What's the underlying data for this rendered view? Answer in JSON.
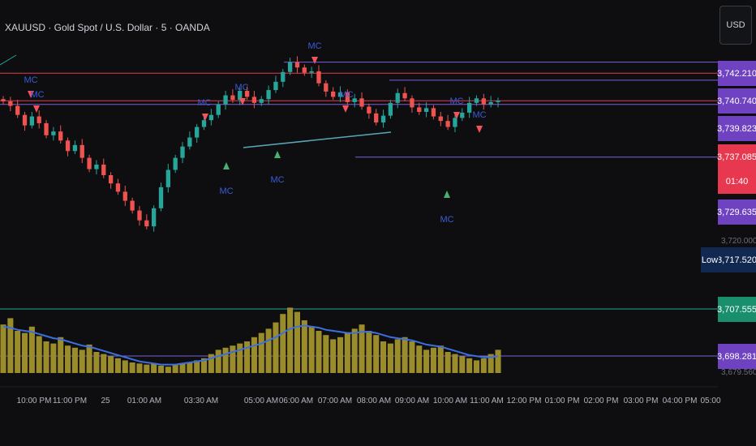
{
  "symbol": {
    "title": "XAUUSD · Gold Spot / U.S. Dollar · 5 · OANDA"
  },
  "currency_button": {
    "label": "USD"
  },
  "price_labels": [
    {
      "value": "3,742.210",
      "color": "#6f42c1"
    },
    {
      "value": "3,740.740",
      "color": "#6f42c1"
    },
    {
      "value": "3,739.823",
      "color": "#6f42c1"
    },
    {
      "value": "3,737.085",
      "color": "#e8384f"
    },
    {
      "value": "01:40",
      "color": "#e8384f"
    },
    {
      "value": "3,729.635",
      "color": "#6f42c1"
    },
    {
      "value": "3,717.520",
      "color": "#112850"
    },
    {
      "value": "3,707.555",
      "color": "#1a8f6e"
    },
    {
      "value": "3,698.281",
      "color": "#6f42c1"
    }
  ],
  "low_tag": "Low",
  "partial_axis_labels": [
    "3,720.000",
    "3,679.560"
  ],
  "time_axis": [
    "10:00 PM",
    "11:00 PM",
    "25",
    "01:00 AM",
    "03:30 AM",
    "05:00 AM",
    "06:00 AM",
    "07:00 AM",
    "08:00 AM",
    "09:00 AM",
    "10:00 AM",
    "11:00 AM",
    "12:00 PM",
    "01:00 PM",
    "02:00 PM",
    "03:00 PM",
    "04:00 PM",
    "05:00"
  ],
  "marker_text": "MC",
  "colors": {
    "bull": "#26a69a",
    "bear": "#ef5350",
    "volume": "#9a8c2a",
    "volume_ma": "#3c6fe0",
    "line_purple": "#7b5fd6",
    "line_red": "#e8384f",
    "line_teal": "#26a69a"
  },
  "chart_data": {
    "type": "candlestick",
    "price_series": [
      3737.0,
      3736.4,
      3735.2,
      3733.8,
      3735.0,
      3734.1,
      3732.5,
      3733.0,
      3731.8,
      3730.4,
      3731.2,
      3729.5,
      3728.0,
      3728.6,
      3727.2,
      3726.1,
      3725.0,
      3723.8,
      3722.5,
      3721.2,
      3720.4,
      3722.8,
      3725.6,
      3727.9,
      3729.5,
      3731.0,
      3732.2,
      3733.6,
      3734.5,
      3735.2,
      3736.6,
      3737.8,
      3737.2,
      3738.4,
      3737.6,
      3736.8,
      3737.3,
      3738.5,
      3739.6,
      3740.9,
      3742.2,
      3741.5,
      3740.8,
      3741.0,
      3739.4,
      3738.3,
      3737.6,
      3738.2,
      3736.9,
      3737.4,
      3736.3,
      3735.4,
      3734.2,
      3735.1,
      3736.8,
      3738.1,
      3737.4,
      3736.2,
      3735.6,
      3736.1,
      3735.0,
      3734.4,
      3733.6,
      3734.8,
      3735.5,
      3736.8,
      3737.4,
      3736.6,
      3736.9,
      3737.1
    ],
    "volume_series": [
      46,
      52,
      40,
      38,
      44,
      35,
      30,
      28,
      34,
      26,
      24,
      22,
      27,
      20,
      18,
      16,
      14,
      12,
      10,
      9,
      8,
      9,
      7,
      6,
      8,
      9,
      10,
      12,
      14,
      18,
      22,
      24,
      26,
      28,
      30,
      34,
      38,
      42,
      48,
      56,
      62,
      58,
      50,
      44,
      40,
      36,
      32,
      34,
      38,
      42,
      46,
      40,
      36,
      30,
      28,
      32,
      34,
      30,
      26,
      22,
      24,
      26,
      20,
      18,
      16,
      14,
      12,
      14,
      18,
      22
    ],
    "volume_ma": [
      44,
      43,
      41,
      40,
      39,
      37,
      35,
      33,
      32,
      30,
      28,
      26,
      25,
      23,
      21,
      19,
      17,
      15,
      13,
      11,
      10,
      9,
      8,
      8,
      8,
      9,
      10,
      11,
      12,
      14,
      16,
      18,
      20,
      22,
      24,
      26,
      28,
      31,
      34,
      38,
      42,
      44,
      45,
      44,
      43,
      41,
      40,
      39,
      38,
      38,
      39,
      39,
      38,
      36,
      34,
      33,
      32,
      31,
      29,
      27,
      26,
      25,
      23,
      21,
      19,
      17,
      16,
      15,
      15,
      16
    ]
  }
}
